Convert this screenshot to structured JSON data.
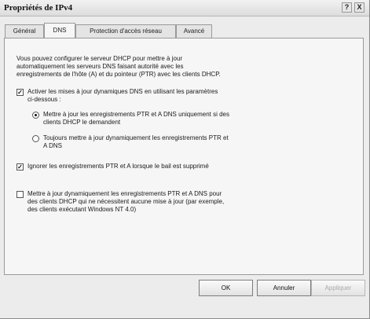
{
  "window": {
    "title": "Propriétés de IPv4",
    "help_glyph": "?",
    "close_glyph": "X"
  },
  "tabs": [
    {
      "label": "Général"
    },
    {
      "label": "DNS"
    },
    {
      "label": "Protection d'accès réseau"
    },
    {
      "label": "Avancé"
    }
  ],
  "active_tab": "DNS",
  "dns": {
    "intro_lines": [
      "Vous pouvez configurer le serveur DHCP pour mettre à jour",
      "automatiquement les serveurs DNS faisant autorité avec les",
      "enregistrements de l'hôte (A) et du pointeur (PTR) avec les clients DHCP."
    ],
    "dynamic_update": {
      "checked": true,
      "lines": [
        "Activer les mises à jour dynamiques DNS en utilisant les paramètres",
        "ci-dessous :"
      ]
    },
    "radio_on_request": {
      "selected": true,
      "lines": [
        "Mettre à jour les enregistrements PTR et A DNS uniquement si des",
        "clients DHCP le demandent"
      ]
    },
    "radio_always": {
      "selected": false,
      "lines": [
        "Toujours mettre à jour dynamiquement les enregistrements PTR et",
        "A DNS"
      ]
    },
    "discard_on_delete": {
      "checked": true,
      "label": "Ignorer les enregistrements PTR et A lorsque le bail est supprimé"
    },
    "legacy_clients": {
      "checked": false,
      "lines": [
        "Mettre à jour dynamiquement les enregistrements PTR et A DNS pour",
        "des clients DHCP qui ne nécessitent aucune mise à jour (par exemple,",
        "des clients exécutant Windows NT 4.0)"
      ]
    }
  },
  "buttons": {
    "ok": "OK",
    "cancel": "Annuler",
    "apply": "Appliquer"
  },
  "check_glyph": "✓"
}
